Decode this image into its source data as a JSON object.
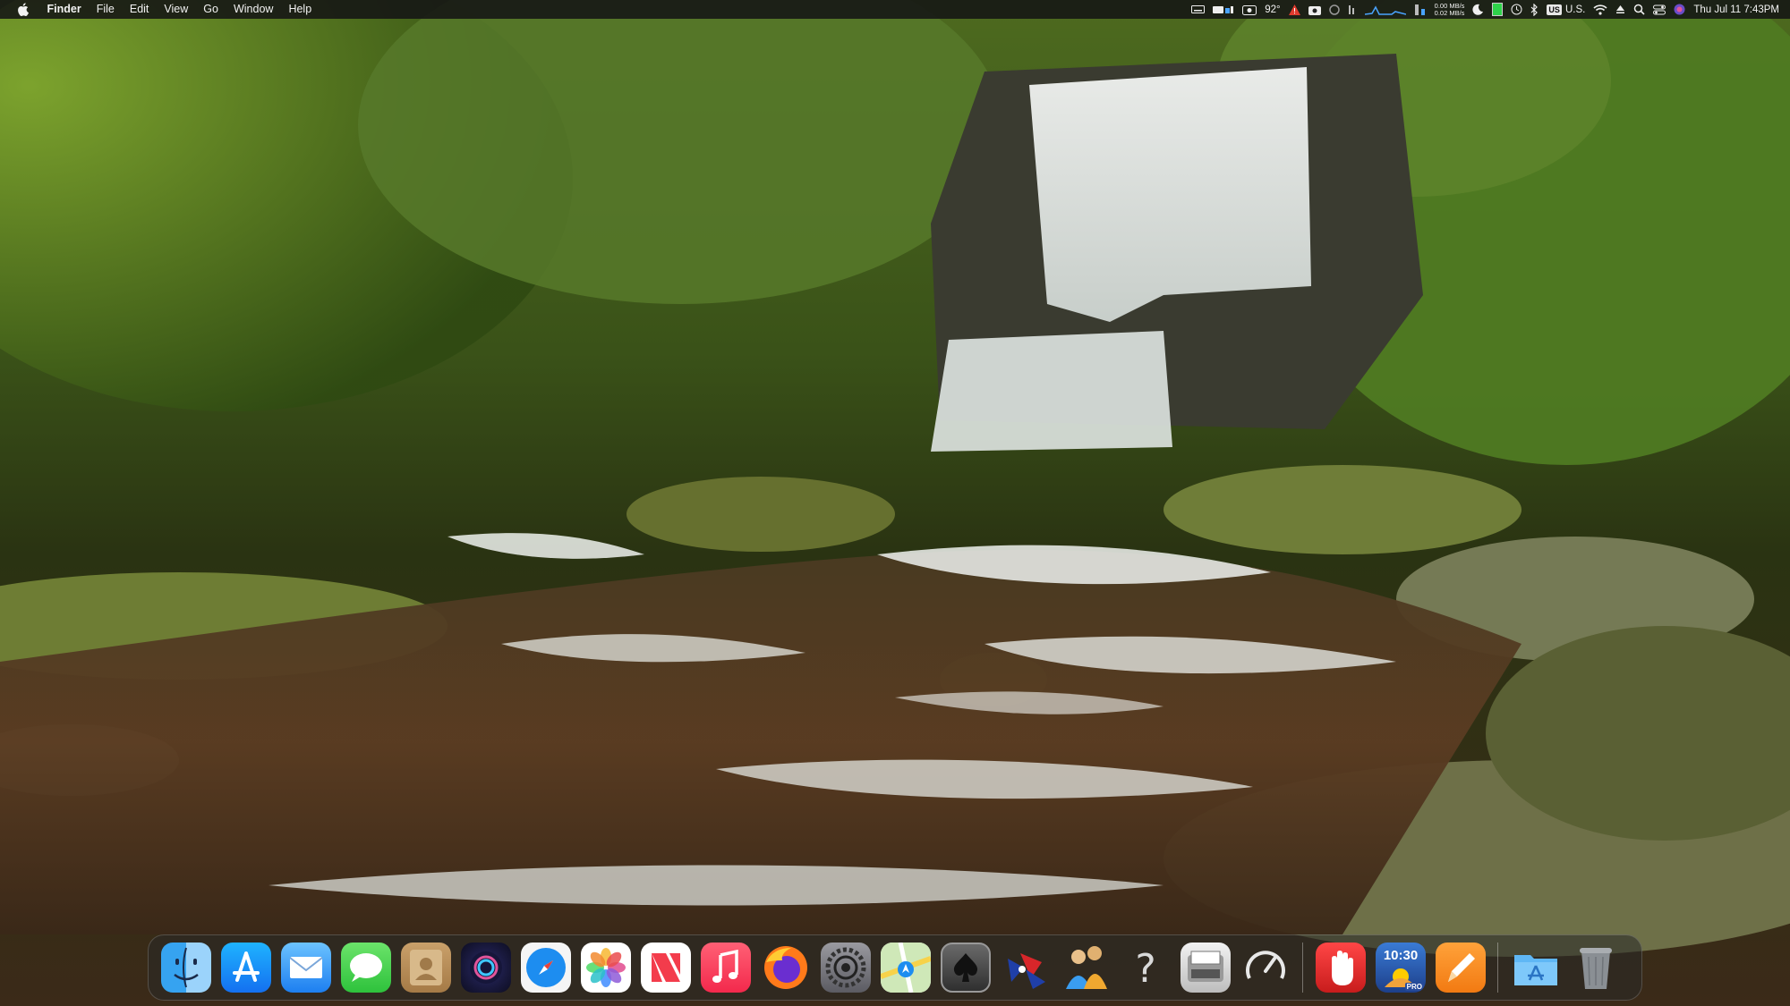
{
  "menubar": {
    "apple_icon": "apple-icon",
    "app_name": "Finder",
    "menus": [
      "File",
      "Edit",
      "View",
      "Go",
      "Window",
      "Help"
    ],
    "status": {
      "temperature": "92°",
      "net_up": "0.00 MB/s",
      "net_down": "0.02 MB/s",
      "keyboard_layout_badge": "US",
      "keyboard_layout": "U.S.",
      "clock": "Thu Jul 11  7:43PM"
    }
  },
  "dock": {
    "apps": [
      {
        "name": "Finder",
        "icon": "finder-icon",
        "running": true
      },
      {
        "name": "App Store",
        "icon": "app-store-icon",
        "running": false
      },
      {
        "name": "Mail",
        "icon": "mail-icon",
        "running": true
      },
      {
        "name": "Messages",
        "icon": "messages-icon",
        "running": true
      },
      {
        "name": "Contacts",
        "icon": "contacts-icon",
        "running": false
      },
      {
        "name": "Siri",
        "icon": "siri-icon",
        "running": false
      },
      {
        "name": "Safari",
        "icon": "safari-icon",
        "running": false
      },
      {
        "name": "Photos",
        "icon": "photos-icon",
        "running": false
      },
      {
        "name": "News",
        "icon": "news-icon",
        "running": false
      },
      {
        "name": "Music",
        "icon": "music-icon",
        "running": false
      },
      {
        "name": "Firefox",
        "icon": "firefox-icon",
        "running": false
      },
      {
        "name": "System Settings",
        "icon": "system-settings-icon",
        "running": false
      },
      {
        "name": "Maps",
        "icon": "maps-icon",
        "running": false
      },
      {
        "name": "Solitaire",
        "icon": "solitaire-icon",
        "running": false
      },
      {
        "name": "Network Utility",
        "icon": "network-icon",
        "running": false
      },
      {
        "name": "Family",
        "icon": "family-icon",
        "running": false
      },
      {
        "name": "Help",
        "icon": "help-icon",
        "running": false
      },
      {
        "name": "Scanner",
        "icon": "scanner-icon",
        "running": false
      },
      {
        "name": "Activity Monitor",
        "icon": "speedometer-icon",
        "running": false
      }
    ],
    "recent_apps": [
      {
        "name": "Stop",
        "icon": "stop-hand-icon",
        "running": false
      },
      {
        "name": "Clock",
        "icon": "clock-app-icon",
        "running": false,
        "clock_text": "10:30",
        "badge": "PRO"
      },
      {
        "name": "Pages",
        "icon": "pencil-icon",
        "running": false
      }
    ],
    "trailing": [
      {
        "name": "Applications",
        "icon": "applications-folder-icon"
      },
      {
        "name": "Trash",
        "icon": "trash-icon"
      }
    ]
  },
  "colors": {
    "menubar_bg": "#141414",
    "temperature_warning": "#e03a2e",
    "battery_green": "#2ed34a"
  }
}
